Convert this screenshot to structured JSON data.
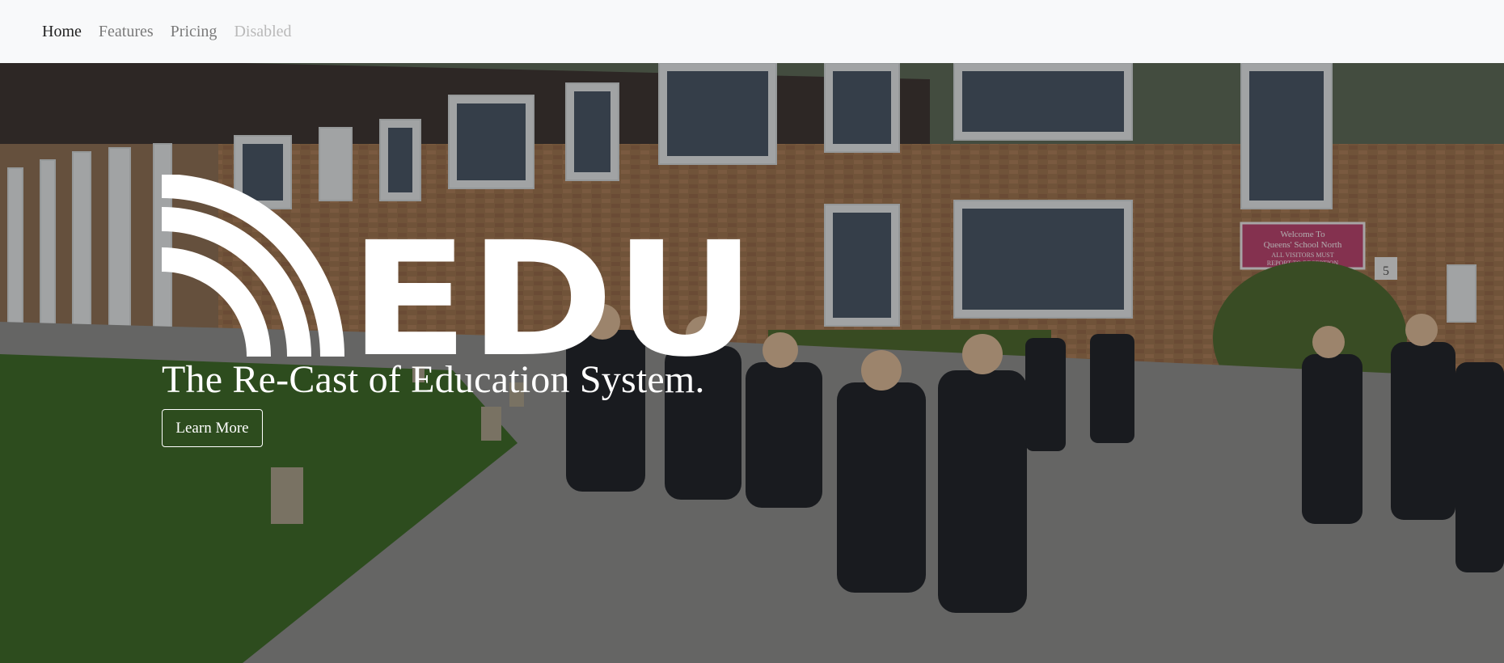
{
  "nav": {
    "items": [
      {
        "label": "Home",
        "state": "active"
      },
      {
        "label": "Features",
        "state": "normal"
      },
      {
        "label": "Pricing",
        "state": "normal"
      },
      {
        "label": "Disabled",
        "state": "disabled"
      }
    ]
  },
  "hero": {
    "logo_text": "EDU",
    "tagline": "The Re-Cast of Education System.",
    "button_label": "Learn More",
    "sign_text": [
      "Welcome To",
      "Queens' School North",
      "ALL VISITORS MUST",
      "REPORT TO RECEPTION"
    ],
    "door_number": "5"
  },
  "colors": {
    "navbar_bg": "#f8f9fa",
    "nav_active": "#222222",
    "nav_muted": "#7a7a7a",
    "nav_disabled": "#b9b9b9",
    "logo": "#ffffff",
    "sign_bg": "#b8456e"
  }
}
